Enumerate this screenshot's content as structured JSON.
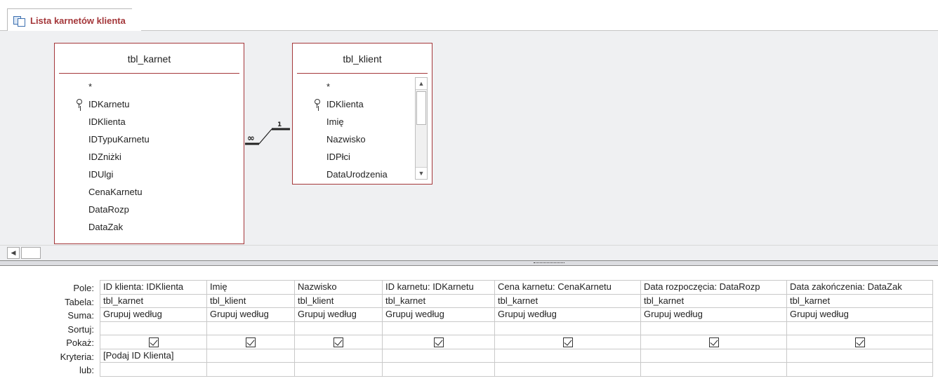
{
  "tab": {
    "label": "Lista karnetów klienta",
    "icon": "query-icon"
  },
  "tables": {
    "karnet": {
      "name": "tbl_karnet",
      "star": "*",
      "fields": [
        "IDKarnetu",
        "IDKlienta",
        "IDTypuKarnetu",
        "IDZniżki",
        "IDUlgi",
        "CenaKarnetu",
        "DataRozp",
        "DataZak"
      ],
      "primary_key": "IDKarnetu"
    },
    "klient": {
      "name": "tbl_klient",
      "star": "*",
      "fields": [
        "IDKlienta",
        "Imię",
        "Nazwisko",
        "IDPłci",
        "DataUrodzenia"
      ],
      "primary_key": "IDKlienta"
    }
  },
  "relationship": {
    "many_symbol": "∞",
    "one_symbol": "1"
  },
  "grid": {
    "row_labels": [
      "Pole:",
      "Tabela:",
      "Suma:",
      "Sortuj:",
      "Pokaż:",
      "Kryteria:",
      "lub:"
    ],
    "columns": [
      {
        "pole": "ID klienta: IDKlienta",
        "tabela": "tbl_karnet",
        "suma": "Grupuj według",
        "sortuj": "",
        "pokaz": true,
        "kryteria": "[Podaj ID Klienta]",
        "lub": ""
      },
      {
        "pole": "Imię",
        "tabela": "tbl_klient",
        "suma": "Grupuj według",
        "sortuj": "",
        "pokaz": true,
        "kryteria": "",
        "lub": ""
      },
      {
        "pole": "Nazwisko",
        "tabela": "tbl_klient",
        "suma": "Grupuj według",
        "sortuj": "",
        "pokaz": true,
        "kryteria": "",
        "lub": ""
      },
      {
        "pole": "ID karnetu: IDKarnetu",
        "tabela": "tbl_karnet",
        "suma": "Grupuj według",
        "sortuj": "",
        "pokaz": true,
        "kryteria": "",
        "lub": ""
      },
      {
        "pole": "Cena karnetu: CenaKarnetu",
        "tabela": "tbl_karnet",
        "suma": "Grupuj według",
        "sortuj": "",
        "pokaz": true,
        "kryteria": "",
        "lub": ""
      },
      {
        "pole": "Data rozpoczęcia: DataRozp",
        "tabela": "tbl_karnet",
        "suma": "Grupuj według",
        "sortuj": "",
        "pokaz": true,
        "kryteria": "",
        "lub": ""
      },
      {
        "pole": "Data zakończenia: DataZak",
        "tabela": "tbl_karnet",
        "suma": "Grupuj według",
        "sortuj": "",
        "pokaz": true,
        "kryteria": "",
        "lub": ""
      }
    ]
  },
  "colors": {
    "accent": "#a4373a",
    "background": "#eff0f2"
  }
}
